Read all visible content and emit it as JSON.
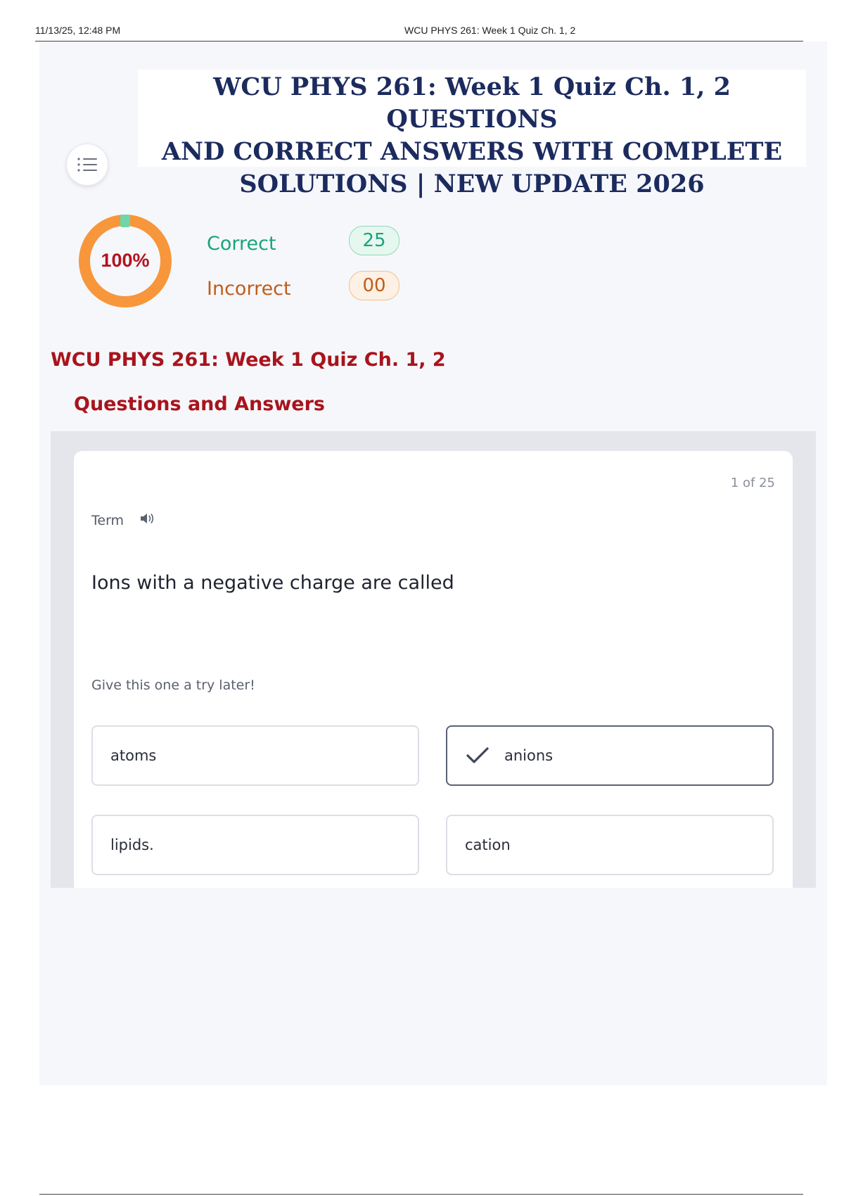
{
  "print_header": {
    "datetime": "11/13/25, 12:48 PM",
    "title": "WCU PHYS 261: Week 1 Quiz Ch. 1, 2"
  },
  "banner": {
    "line1": "WCU PHYS 261: Week 1 Quiz Ch. 1, 2 QUESTIONS",
    "line2": "AND CORRECT ANSWERS WITH COMPLETE",
    "line3": "SOLUTIONS | NEW UPDATE 2026"
  },
  "menu_icon": "list-icon",
  "score": {
    "percent_label": "100%",
    "percent_value": 100,
    "correct_label": "Correct",
    "correct_count": "25",
    "incorrect_label": "Incorrect",
    "incorrect_count": "00"
  },
  "quiz": {
    "title": "WCU PHYS 261: Week 1 Quiz Ch. 1, 2",
    "subtitle": "Questions and Answers"
  },
  "card": {
    "counter": "1 of 25",
    "term_label": "Term",
    "speaker_icon": "speaker-icon",
    "question": "Ions with a negative charge are called",
    "hint": "Give this one a try later!",
    "options": [
      {
        "label": "atoms",
        "selected": false
      },
      {
        "label": "anions",
        "selected": true
      },
      {
        "label": "lipids.",
        "selected": false
      },
      {
        "label": "cation",
        "selected": false
      }
    ]
  },
  "colors": {
    "ring": "#f7963b",
    "ring_marker": "#6fd6a8",
    "heading_red": "#a8141c",
    "banner_navy": "#1c2b5e",
    "correct_green": "#1aa37a",
    "incorrect_orange": "#c05d1a"
  }
}
